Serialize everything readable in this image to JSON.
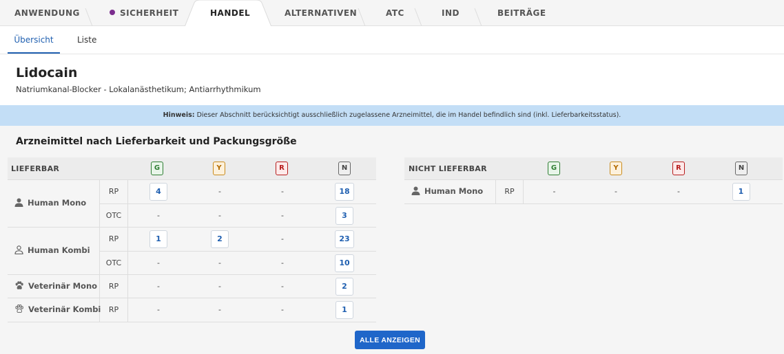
{
  "top_tabs": [
    {
      "label": "ANWENDUNG"
    },
    {
      "label": "SICHERHEIT"
    },
    {
      "label": "HANDEL"
    },
    {
      "label": "ALTERNATIVEN"
    },
    {
      "label": "ATC"
    },
    {
      "label": "IND"
    },
    {
      "label": "BEITRÄGE"
    }
  ],
  "sub_tabs": [
    {
      "label": "Übersicht"
    },
    {
      "label": "Liste"
    }
  ],
  "header": {
    "title": "Lidocain",
    "subtitle": "Natriumkanal-Blocker - Lokalanästhetikum; Antiarrhythmikum"
  },
  "banner": {
    "label": "Hinweis:",
    "text": " Dieser Abschnitt berücksichtigt ausschließlich zugelassene Arzneimittel, die im Handel befindlich sind (inkl. Lieferbarkeitsstatus)."
  },
  "section_title": "Arzneimittel nach Lieferbarkeit und Packungsgröße",
  "badges": [
    "G",
    "Y",
    "R",
    "N"
  ],
  "lieferbar": {
    "heading": "LIEFERBAR",
    "groups": [
      {
        "label": "Human Mono",
        "icon": "person-filled-icon",
        "rows": [
          {
            "kind": "RP",
            "values": [
              "4",
              "-",
              "-",
              "18"
            ]
          },
          {
            "kind": "OTC",
            "values": [
              "-",
              "-",
              "-",
              "3"
            ]
          }
        ]
      },
      {
        "label": "Human Kombi",
        "icon": "person-outline-icon",
        "rows": [
          {
            "kind": "RP",
            "values": [
              "1",
              "2",
              "-",
              "23"
            ]
          },
          {
            "kind": "OTC",
            "values": [
              "-",
              "-",
              "-",
              "10"
            ]
          }
        ]
      },
      {
        "label": "Veterinär Mono",
        "icon": "paw-filled-icon",
        "rows": [
          {
            "kind": "RP",
            "values": [
              "-",
              "-",
              "-",
              "2"
            ]
          }
        ]
      },
      {
        "label": "Veterinär Kombi",
        "icon": "paw-outline-icon",
        "rows": [
          {
            "kind": "RP",
            "values": [
              "-",
              "-",
              "-",
              "1"
            ]
          }
        ]
      }
    ]
  },
  "nicht_lieferbar": {
    "heading": "NICHT LIEFERBAR",
    "groups": [
      {
        "label": "Human Mono",
        "icon": "person-filled-icon",
        "rows": [
          {
            "kind": "RP",
            "values": [
              "-",
              "-",
              "-",
              "1"
            ]
          }
        ]
      }
    ]
  },
  "button": {
    "label": "ALLE ANZEIGEN"
  },
  "colors": {
    "accent": "#1f66c9",
    "banner": "#c3def6",
    "sicherheit_dot": "#7b2d8e"
  }
}
